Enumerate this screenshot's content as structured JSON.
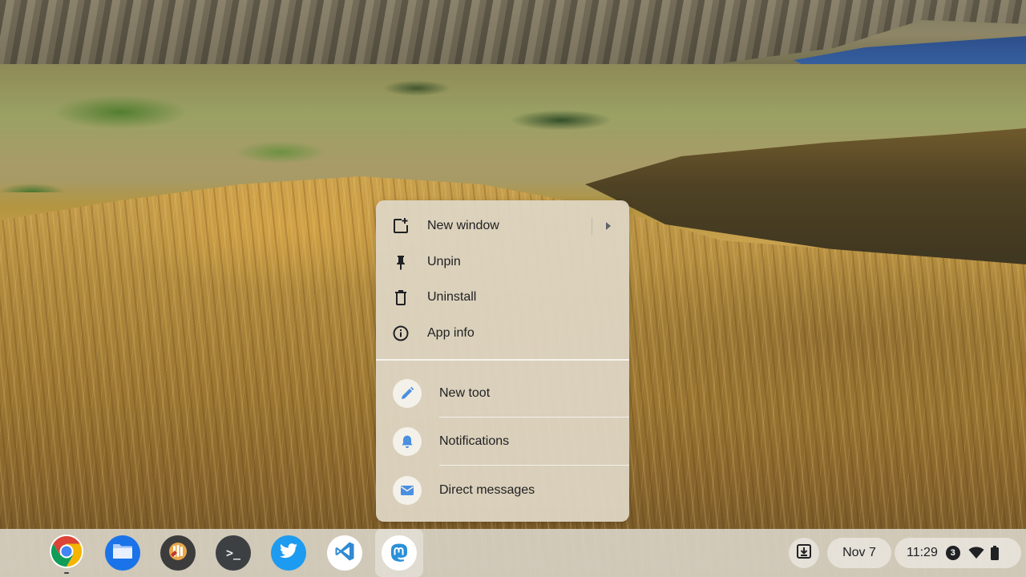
{
  "menu": {
    "items": [
      {
        "label": "New window",
        "icon": "new-window-icon",
        "has_submenu": true
      },
      {
        "label": "Unpin",
        "icon": "pin-icon"
      },
      {
        "label": "Uninstall",
        "icon": "trash-icon"
      },
      {
        "label": "App info",
        "icon": "info-icon"
      }
    ],
    "shortcuts": [
      {
        "label": "New toot",
        "icon": "pencil-icon"
      },
      {
        "label": "Notifications",
        "icon": "bell-icon"
      },
      {
        "label": "Direct messages",
        "icon": "mail-icon"
      }
    ]
  },
  "shelf": {
    "apps": [
      {
        "name": "Chrome",
        "icon": "chrome-icon"
      },
      {
        "name": "Files",
        "icon": "files-icon"
      },
      {
        "name": "Linux app",
        "icon": "app-icon"
      },
      {
        "name": "Terminal",
        "icon": "terminal-icon"
      },
      {
        "name": "Twitter",
        "icon": "twitter-icon"
      },
      {
        "name": "Visual Studio Code",
        "icon": "vscode-icon"
      },
      {
        "name": "Mastodon",
        "icon": "mastodon-icon"
      }
    ],
    "terminal_glyph": ">_"
  },
  "tray": {
    "date": "Nov 7",
    "time": "11:29",
    "notification_count": "3"
  },
  "colors": {
    "accent_blue": "#1a73e8",
    "shortcut_icon_blue": "#4a8fe0",
    "twitter_blue": "#1d9bf0",
    "mastodon_blue": "#2b90d9",
    "vscode_blue": "#2f8ad3",
    "text": "#202124"
  }
}
